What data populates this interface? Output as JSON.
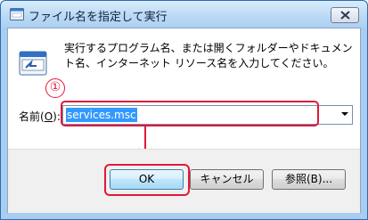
{
  "window": {
    "title": "ファイル名を指定して実行"
  },
  "dialog": {
    "description": "実行するプログラム名、または開くフォルダーやドキュメント名、インターネット リソース名を入力してください。",
    "name_label": "名前(",
    "name_accel": "O",
    "name_label_end": "):",
    "input_value": "services.msc"
  },
  "annotation": {
    "number": "①",
    "color": "#e0193a"
  },
  "buttons": {
    "ok_label": "OK",
    "cancel_label": "キャンセル",
    "browse_label": "参照(B)..."
  }
}
